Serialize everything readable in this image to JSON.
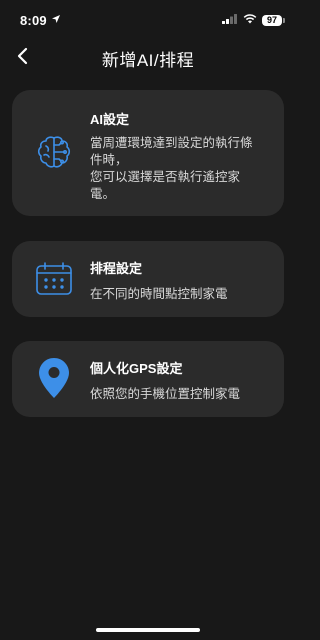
{
  "status_bar": {
    "time": "8:09",
    "battery": "97",
    "icons": [
      "location-arrow-icon",
      "signal-icon",
      "wifi-icon",
      "battery-icon"
    ]
  },
  "nav": {
    "title": "新增AI/排程",
    "back_icon": "chevron-left-icon"
  },
  "cards": [
    {
      "title": "AI設定",
      "description_lines": [
        "當周遭環境達到設定的執行條",
        "件時，",
        "您可以選擇是否執行遙控家",
        "電。"
      ],
      "icon": "brain-icon"
    },
    {
      "title": "排程設定",
      "description_lines": [
        "在不同的時間點控制家電"
      ],
      "icon": "calendar-icon"
    },
    {
      "title": "個人化GPS設定",
      "description_lines": [
        "依照您的手機位置控制家電"
      ],
      "icon": "map-pin-icon"
    }
  ],
  "colors": {
    "background": "#181818",
    "card": "#2b2b2b",
    "accent": "#3d8fe8"
  }
}
